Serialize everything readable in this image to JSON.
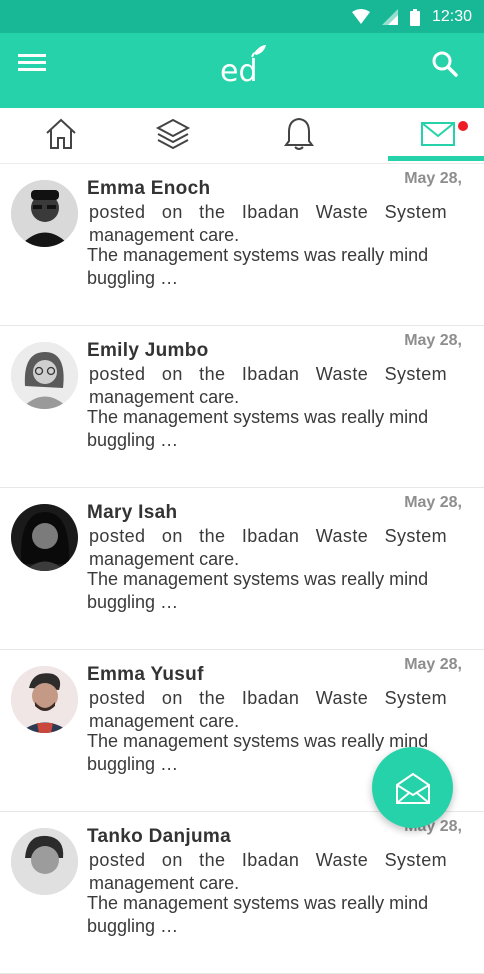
{
  "status": {
    "time": "12:30"
  },
  "appbar": {
    "logo_text": "ed"
  },
  "tabs": [
    {
      "icon": "home-icon"
    },
    {
      "icon": "layers-icon"
    },
    {
      "icon": "bell-icon"
    },
    {
      "icon": "mail-icon",
      "active": true,
      "badge": true
    }
  ],
  "messages": [
    {
      "name": "Emma Enoch",
      "date": "May 28,",
      "posted": "posted on the Ibadan Waste System",
      "subject": "management care.",
      "preview": "The management systems was really mind buggling …"
    },
    {
      "name": "Emily Jumbo",
      "date": "May 28,",
      "posted": "posted on the Ibadan Waste System",
      "subject": "management care.",
      "preview": "The management systems was really mind buggling …"
    },
    {
      "name": "Mary Isah",
      "date": "May 28,",
      "posted": "posted on the Ibadan Waste System",
      "subject": "management care.",
      "preview": "The management systems was really mind buggling …"
    },
    {
      "name": "Emma Yusuf",
      "date": "May 28,",
      "posted": "posted on the Ibadan Waste System",
      "subject": "management care.",
      "preview": "The management systems was really mind buggling …"
    },
    {
      "name": "Tanko Danjuma",
      "date": "May 28,",
      "posted": "posted on the Ibadan Waste System",
      "subject": "management care.",
      "preview": "The management systems was really mind buggling …"
    }
  ],
  "colors": {
    "primary": "#26d2a9",
    "status_bar": "#18b796",
    "badge": "#ee1c25"
  }
}
